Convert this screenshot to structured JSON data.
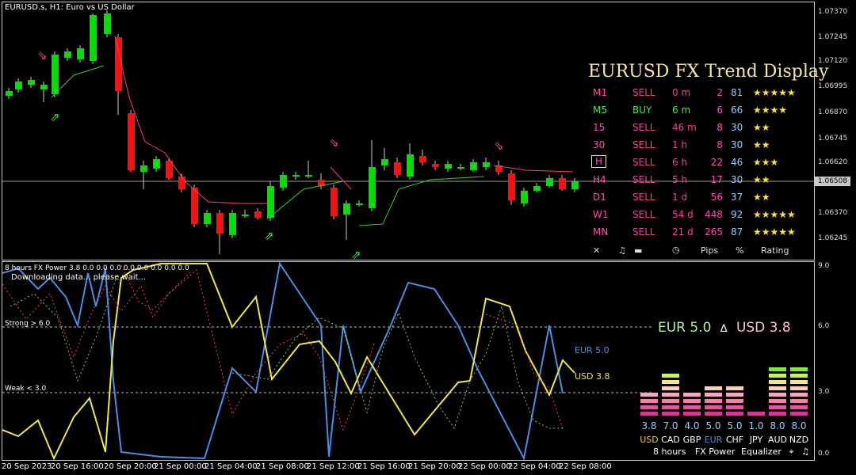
{
  "main_chart": {
    "title": "EURUSD.s, H1:  Euro vs US Dollar",
    "price_labels": [
      "1.07370",
      "1.07245",
      "1.07120",
      "1.06995",
      "1.06870",
      "1.06745",
      "1.06620",
      "1.06508",
      "1.06370",
      "1.06245"
    ],
    "current_price": "1.06508",
    "colors": {
      "bull": "#00e000",
      "bear": "#ff1010",
      "ma_up": "#32cd32",
      "ma_down": "#ff3b6e",
      "border": "#c8c8c8"
    }
  },
  "trend_display": {
    "title": "EURUSD FX Trend Display",
    "rows": [
      {
        "tf": "M1",
        "signal": "SELL",
        "time": "0 m",
        "pips": "2",
        "pct": "81",
        "stars": "★★★★★"
      },
      {
        "tf": "M5",
        "signal": "BUY",
        "time": "6 m",
        "pips": "6",
        "pct": "66",
        "stars": "★★★★"
      },
      {
        "tf": "15",
        "signal": "SELL",
        "time": "46 m",
        "pips": "8",
        "pct": "30",
        "stars": "★★"
      },
      {
        "tf": "30",
        "signal": "SELL",
        "time": "1 h",
        "pips": "8",
        "pct": "30",
        "stars": "★★"
      },
      {
        "tf": "H",
        "signal": "SELL",
        "time": "6 h",
        "pips": "22",
        "pct": "46",
        "stars": "★★★"
      },
      {
        "tf": "H4",
        "signal": "SELL",
        "time": "5 h",
        "pips": "17",
        "pct": "30",
        "stars": "★★"
      },
      {
        "tf": "D1",
        "signal": "SELL",
        "time": "1 d",
        "pips": "56",
        "pct": "37",
        "stars": "★★"
      },
      {
        "tf": "W1",
        "signal": "SELL",
        "time": "54 d",
        "pips": "448",
        "pct": "92",
        "stars": "★★★★★"
      },
      {
        "tf": "MN",
        "signal": "SELL",
        "time": "21 d",
        "pips": "265",
        "pct": "87",
        "stars": "★★★★★"
      }
    ],
    "footer": {
      "pips": "Pips",
      "pct": "%",
      "rating": "Rating"
    },
    "icons": [
      "close-icon",
      "music-note-icon",
      "wave-icon",
      "clock-icon"
    ]
  },
  "sub_chart": {
    "title": "8 hours FX Power 3.8 0.0 0.0 0.0 0.0 0.0 0.0 0.0 0.0",
    "status": "Downloading data... please wait...",
    "strong_label": "Strong > 6.0",
    "weak_label": "Weak < 3.0",
    "axis": [
      "9.0",
      "6.0",
      "3.0",
      "0.0"
    ],
    "eur_label": "EUR 5.0",
    "usd_label": "USD 3.8",
    "colors": {
      "eur": "#4a90e2",
      "usd": "#f2e64a"
    }
  },
  "equalizer": {
    "eur_text": "EUR 5.0",
    "delta": "∆",
    "usd_text": "USD 3.8",
    "currencies": [
      {
        "code": "USD",
        "value": "3.8",
        "level": 3.8,
        "color": "#f5c518"
      },
      {
        "code": "CAD",
        "value": "7.0",
        "level": 7.0,
        "color": "#ffffff"
      },
      {
        "code": "GBP",
        "value": "4.0",
        "level": 4.0,
        "color": "#ffffff"
      },
      {
        "code": "EUR",
        "value": "5.0",
        "level": 5.0,
        "color": "#4a90e2"
      },
      {
        "code": "CHF",
        "value": "5.0",
        "level": 5.0,
        "color": "#ffffff"
      },
      {
        "code": "JPY",
        "value": "1.0",
        "level": 1.0,
        "color": "#ffffff"
      },
      {
        "code": "AUD",
        "value": "8.0",
        "level": 8.0,
        "color": "#ffffff"
      },
      {
        "code": "NZD",
        "value": "8.0",
        "level": 8.0,
        "color": "#ffffff"
      }
    ],
    "footer": {
      "hours": "8 hours",
      "power": "FX Power",
      "eq": "Equalizer"
    }
  },
  "time_axis": [
    "20 Sep 2023",
    "20 Sep 16:00",
    "20 Sep 20:00",
    "21 Sep 00:00",
    "21 Sep 04:00",
    "21 Sep 08:00",
    "21 Sep 12:00",
    "21 Sep 16:00",
    "21 Sep 20:00",
    "22 Sep 00:00",
    "22 Sep 04:00",
    "22 Sep 08:00"
  ]
}
